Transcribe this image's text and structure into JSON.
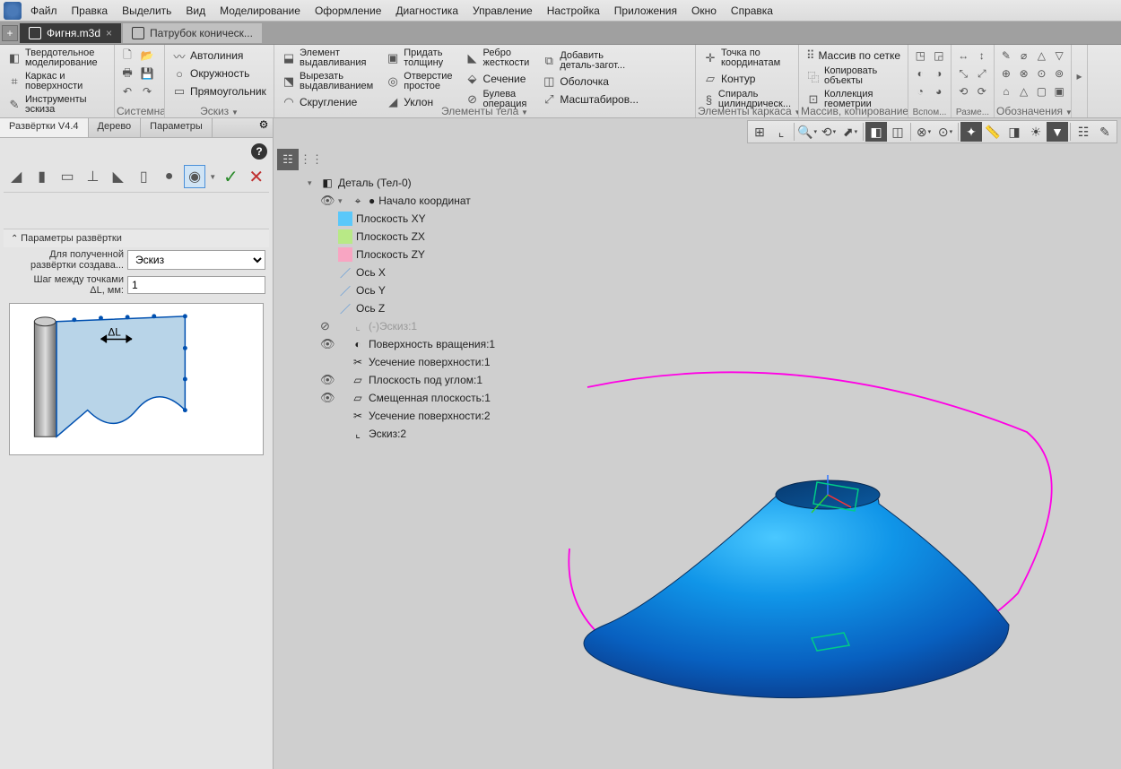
{
  "menu": [
    "Файл",
    "Правка",
    "Выделить",
    "Вид",
    "Моделирование",
    "Оформление",
    "Диагностика",
    "Управление",
    "Настройка",
    "Приложения",
    "Окно",
    "Справка"
  ],
  "tabs": {
    "active": "Фигня.m3d",
    "inactive": "Патрубок коническ..."
  },
  "ribbon": {
    "g1": {
      "solid": "Твердотельное\nмоделирование",
      "wire": "Каркас и\nповерхности",
      "sketch": "Инструменты\nэскиза"
    },
    "sys": "Системная",
    "sketchgrp": "Эскиз",
    "auto": "Автолиния",
    "circle": "Окружность",
    "rect": "Прямоугольник",
    "body": "Элементы тела",
    "extrude": "Элемент\nвыдавливания",
    "cut": "Вырезать\nвыдавливанием",
    "fillet": "Скругление",
    "thick": "Придать\nтолщину",
    "hole": "Отверстие\nпростое",
    "draft": "Уклон",
    "rib": "Ребро\nжесткости",
    "section": "Сечение",
    "bool": "Булева\nоперация",
    "addpart": "Добавить\nдеталь-загот...",
    "shell": "Оболочка",
    "scale": "Масштабиров...",
    "frame": "Элементы каркаса",
    "point": "Точка по\nкоординатам",
    "contour": "Контур",
    "spiral": "Спираль\nцилиндрическ...",
    "arr": "Массив, копирование",
    "grid": "Массив по сетке",
    "copy": "Копировать\nобъекты",
    "geom": "Коллекция\nгеометрии",
    "aux": "Вспом...",
    "dim": "Разме...",
    "ann": "Обозначения"
  },
  "left": {
    "tabs": [
      "Развёртки V4.4",
      "Дерево",
      "Параметры"
    ],
    "sec": "Параметры развёртки",
    "p1lbl": "Для полученной\nразвёртки создава...",
    "p1val": "Эскиз",
    "p2lbl": "Шаг между точками\nΔL, мм:",
    "p2val": "1",
    "dl": "ΔL"
  },
  "tree": {
    "root": "Деталь (Тел-0)",
    "origin": "Начало координат",
    "pxy": "Плоскость XY",
    "pzx": "Плоскость ZX",
    "pzy": "Плоскость ZY",
    "ax": "Ось X",
    "ay": "Ось Y",
    "az": "Ось Z",
    "sk1": "(-)Эскиз:1",
    "rev": "Поверхность вращения:1",
    "tr1": "Усечение поверхности:1",
    "ang": "Плоскость под углом:1",
    "off": "Смещенная плоскость:1",
    "tr2": "Усечение поверхности:2",
    "sk2": "Эскиз:2"
  }
}
